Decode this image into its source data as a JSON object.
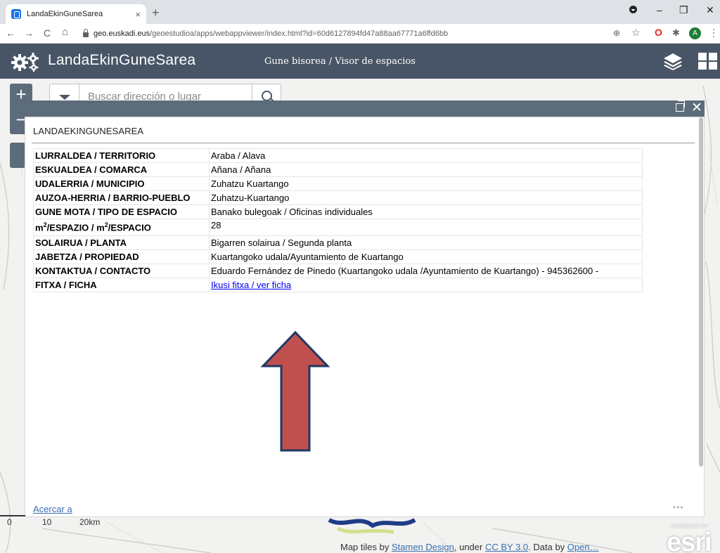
{
  "browser": {
    "tab_title": "LandaEkinGuneSarea",
    "tab_close": "×",
    "new_tab": "+",
    "url_domain": "geo.euskadi.eus",
    "url_path": "/geoestudioa/apps/webappviewer/index.html?id=60d6127894fd47a88aa67771a6ffd6bb",
    "profile_initial": "A",
    "back": "←",
    "forward": "→",
    "reload": "C",
    "home": "⌂",
    "zoom_ext": "⊕",
    "star": "☆",
    "opera_ext": "O",
    "puzzle_ext": "✱",
    "menu": "⋮",
    "minimize": "–",
    "restore": "❐",
    "close": "✕"
  },
  "app": {
    "title": "LandaEkinGuneSarea",
    "subtitle": "Gune bisorea / Visor de espacios",
    "header_color": "#485566"
  },
  "map": {
    "zoom_in": "+",
    "zoom_out": "−",
    "search_placeholder": "Buscar dirección o lugar",
    "scale_labels": [
      "0",
      "10",
      "20km"
    ],
    "attribution_prefix": "Map tiles by ",
    "attribution_link1": "Stamen Design",
    "attribution_mid": ", under ",
    "attribution_link2": "CC BY 3.0",
    "attribution_mid2": ". Data by ",
    "attribution_link3": "Open…",
    "esri_powered": "POWERED BY",
    "esri_word": "esri"
  },
  "popup": {
    "title": "LANDAEKINGUNESAREA",
    "rows": [
      {
        "key": "LURRALDEA / TERRITORIO",
        "value": "Araba / Alava"
      },
      {
        "key": "ESKUALDEA / COMARCA",
        "value": "Añana / Añana"
      },
      {
        "key": "UDALERRIA / MUNICIPIO",
        "value": "Zuhatzu Kuartango"
      },
      {
        "key": "AUZOA-HERRIA / BARRIO-PUEBLO",
        "value": "Zuhatzu-Kuartango"
      },
      {
        "key": "GUNE MOTA / TIPO DE ESPACIO",
        "value": "Banako bulegoak / Oficinas individuales"
      },
      {
        "key_prefix": "m",
        "key_sup": "2",
        "key_mid": "/ESPAZIO / m",
        "key_sup2": "2",
        "key_suffix": "/ESPACIO",
        "value": "28"
      },
      {
        "key": "SOLAIRUA / PLANTA",
        "value": "Bigarren solairua / Segunda planta"
      },
      {
        "key": "JABETZA / PROPIEDAD",
        "value": "Kuartangoko udala/Ayuntamiento de Kuartango"
      },
      {
        "key": "KONTAKTUA / CONTACTO",
        "value": "Eduardo Fernández de Pinedo (Kuartangoko udala /Ayuntamiento de Kuartango) - 945362600 -"
      },
      {
        "key": "FITXA / FICHA",
        "link": "Ikusi fitxa / ver ficha"
      }
    ],
    "zoom_link": "Acercar a",
    "more_dots": "•••",
    "close": "✕"
  },
  "annotation": {
    "arrow_fill": "#c0504d",
    "arrow_stroke": "#1f3864"
  }
}
